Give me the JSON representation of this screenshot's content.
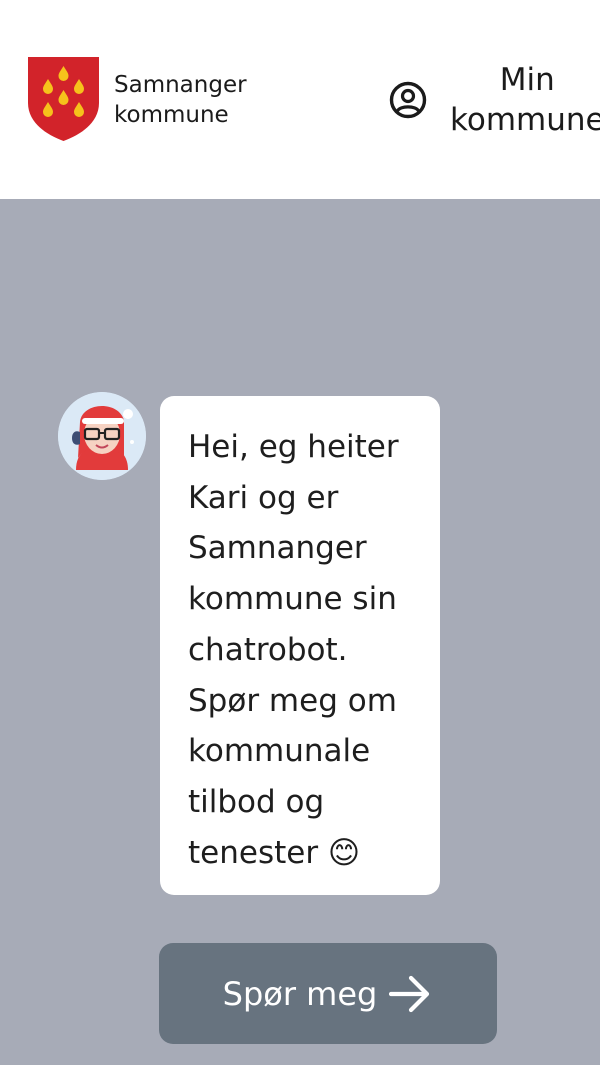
{
  "header": {
    "brand_line1": "Samnanger",
    "brand_line2": "kommune",
    "mine_line1": "Min",
    "mine_line2": "kommune"
  },
  "chat": {
    "message": "Hei, eg heiter\nKari og er\nSamnanger\nkommune sin\nchatrobot.\nSpør meg om\nkommunale\ntilbod og\ntenester 😊",
    "button_label": "Spør meg"
  },
  "icons": {
    "logo": "samnanger-coat-of-arms-icon",
    "user": "user-circle-icon",
    "avatar": "santa-chatbot-avatar",
    "arrow": "arrow-right-icon"
  },
  "colors": {
    "shield_red": "#d2232a",
    "shield_gold": "#f6c21b",
    "background_grey": "#a7abb7",
    "button": "#67737f"
  }
}
